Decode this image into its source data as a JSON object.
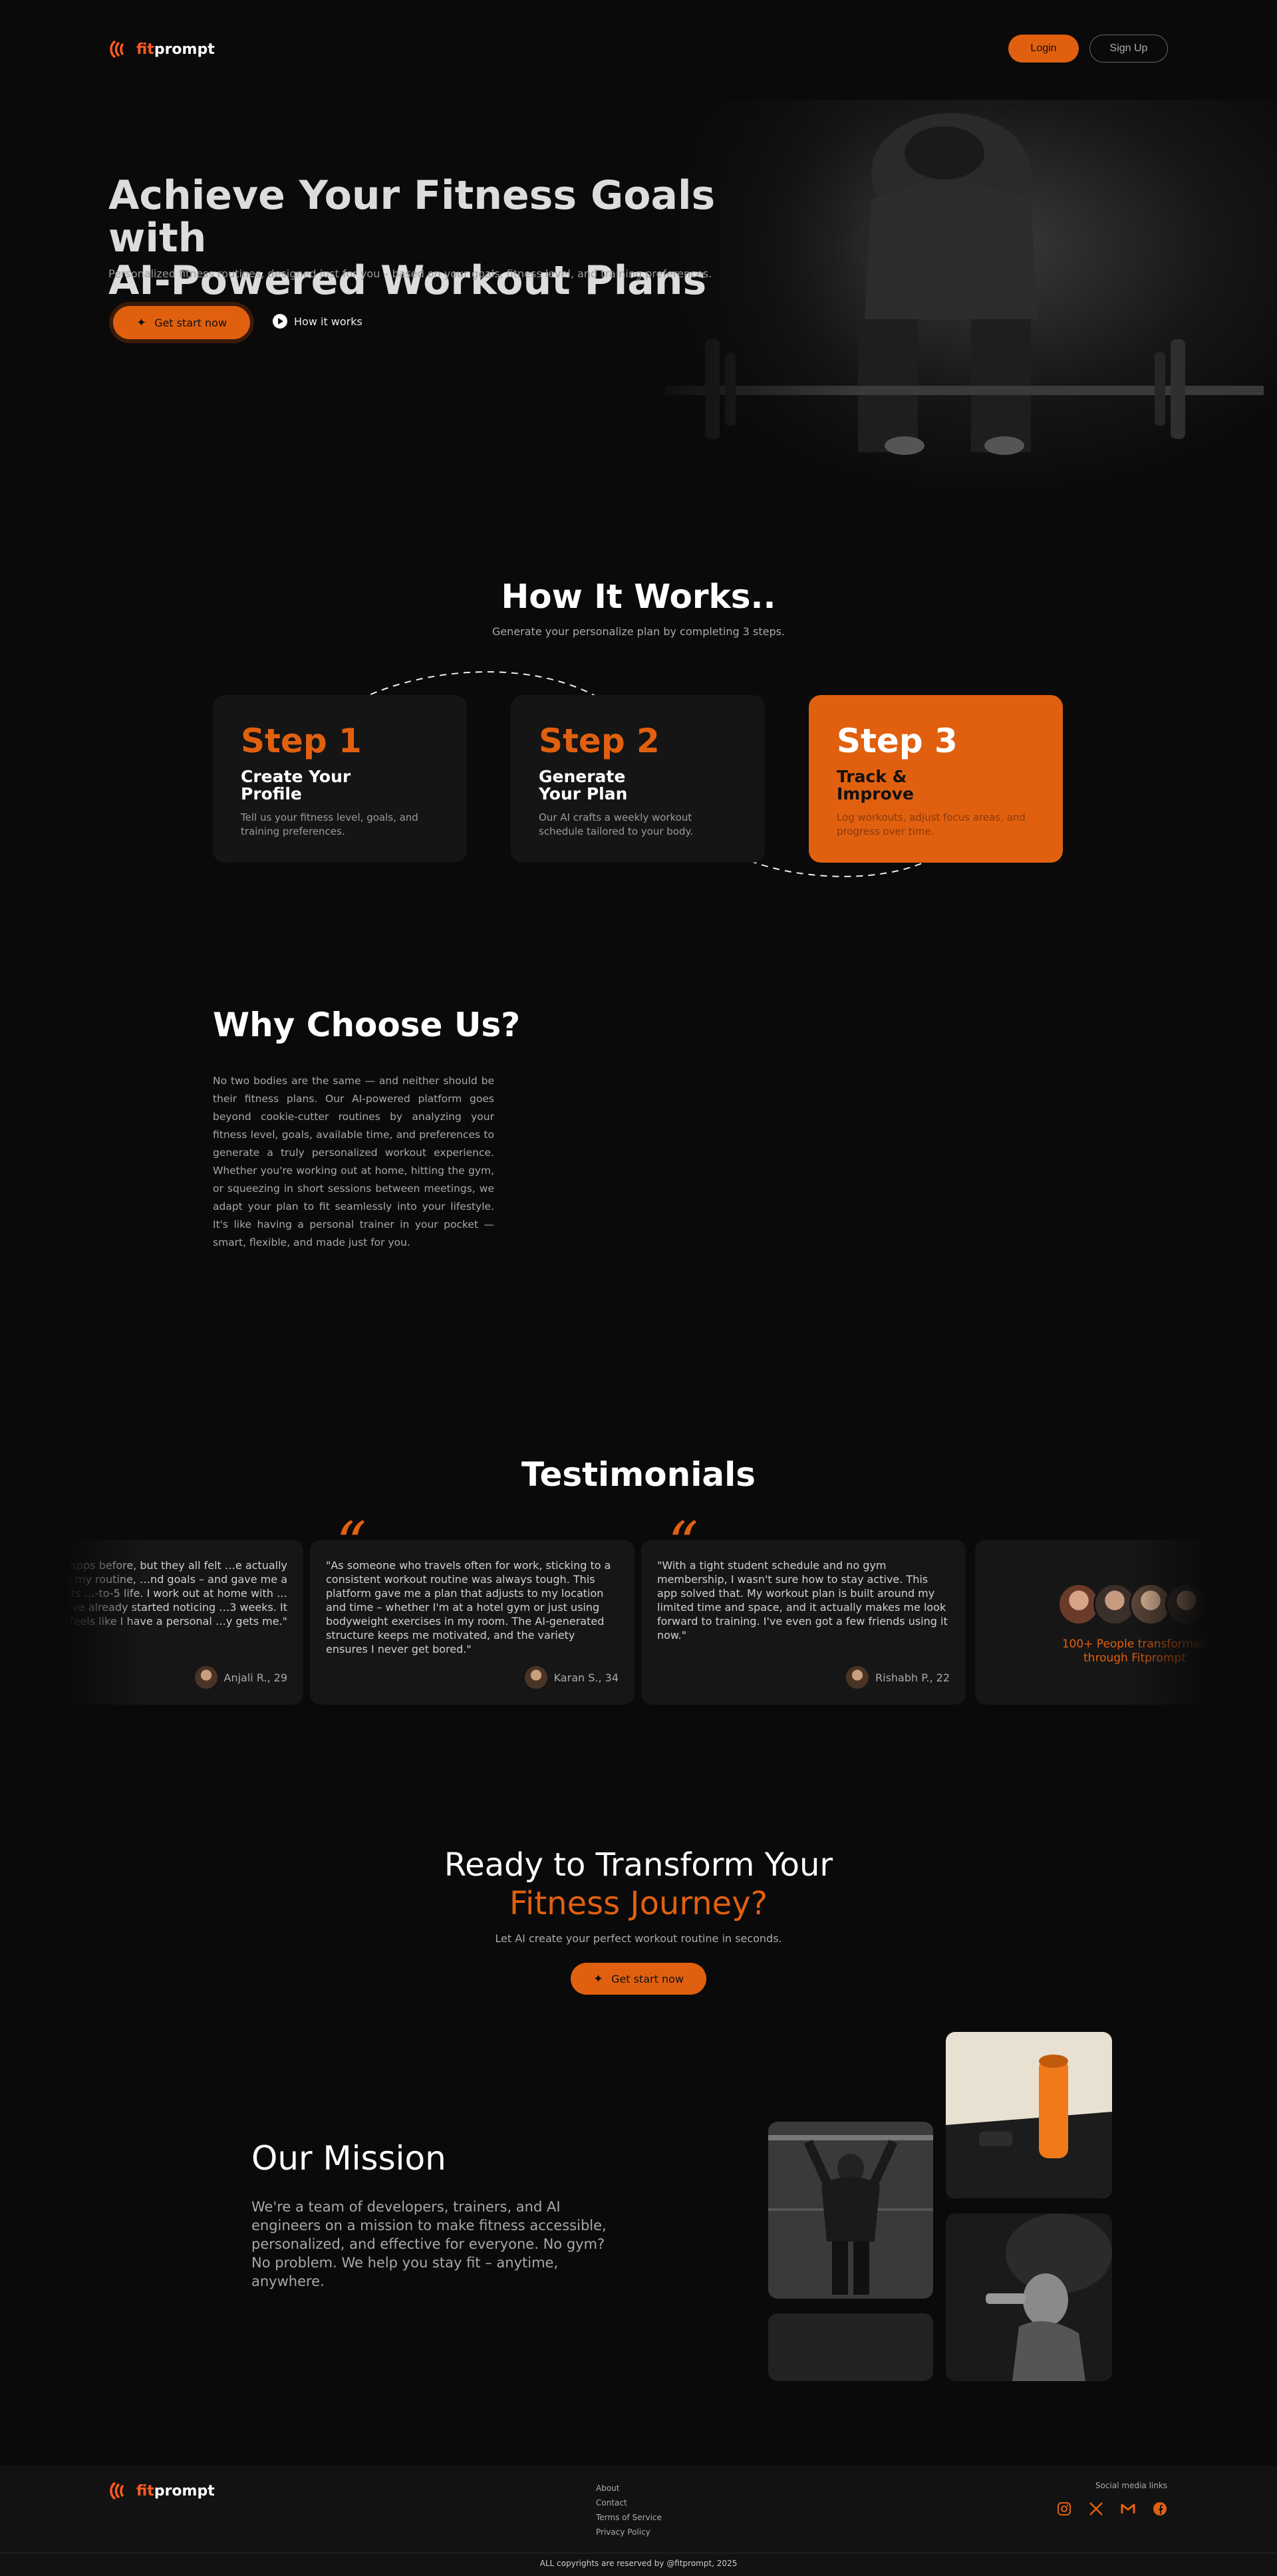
{
  "brand": {
    "prefix": "fit",
    "name": "prompt",
    "accent": "#e1600f"
  },
  "nav": {
    "login": "Login",
    "signup": "Sign Up"
  },
  "hero": {
    "title_line1": "Achieve Your Fitness Goals with",
    "title_line2": "AI-Powered Workout Plans",
    "subtitle": "Personalized fitness routines, designed just for you – based on your goals, fitness level, and training preferences.",
    "cta": "Get start now",
    "how_link": "How it works"
  },
  "how": {
    "title": "How It Works..",
    "subtitle": "Generate your personalize plan by completing 3 steps.",
    "steps": [
      {
        "num": "Step 1",
        "head": "Create Your Profile",
        "desc": "Tell us your fitness level, goals, and training preferences."
      },
      {
        "num": "Step 2",
        "head": "Generate Your Plan",
        "desc": "Our AI crafts a weekly workout schedule tailored to your body."
      },
      {
        "num": "Step 3",
        "head": "Track & Improve",
        "desc": "Log workouts, adjust focus areas, and progress over time."
      }
    ]
  },
  "why": {
    "title": "Why Choose Us?",
    "text": "No two bodies are the same — and neither should be their fitness plans. Our AI-powered platform goes beyond cookie-cutter routines by analyzing your fitness level, goals, available time, and preferences to generate a truly personalized workout experience. Whether you're working out at home, hitting the gym, or squeezing in short sessions between meetings, we adapt your plan to fit seamlessly into your lifestyle. It's like having a personal trainer in your pocket — smart, flexible, and made just for you."
  },
  "testimonials": {
    "title": "Testimonials",
    "items": [
      {
        "text": "…al fitness apps before, but they all felt …e actually asked about my routine, …nd goals – and gave me a plan that fits …-to-5 life. I work out at home with …ment, and I've already started noticing …3 weeks. It feels like I have a personal …y gets me.\"",
        "who": "Anjali R., 29"
      },
      {
        "text": "\"As someone who travels often for work, sticking to a consistent workout routine was always tough. This platform gave me a plan that adjusts to my location and time – whether I'm at a hotel gym or just using bodyweight exercises in my room. The AI-generated structure keeps me motivated, and the variety ensures I never get bored.\"",
        "who": "Karan S., 34"
      },
      {
        "text": "\"With a tight student schedule and no gym membership, I wasn't sure how to stay active. This app solved that. My workout plan is built around my limited time and space, and it actually makes me look forward to training. I've even got a few friends using it now.\"",
        "who": "Rishabh P., 22"
      }
    ],
    "people": "100+ People transformed through Fitprompt"
  },
  "cta": {
    "line1": "Ready to Transform Your",
    "line2": "Fitness Journey?",
    "subtitle": "Let AI create your perfect workout routine in seconds.",
    "button": "Get start now"
  },
  "mission": {
    "title": "Our Mission",
    "text": "We're a team of developers, trainers, and AI engineers on a mission to make fitness accessible, personalized, and effective for everyone. No gym? No problem. We help you stay fit – anytime, anywhere."
  },
  "footer": {
    "links": [
      "About",
      "Contact",
      "Terms of Service",
      "Privacy Policy"
    ],
    "social_label": "Social media links",
    "social_icons": [
      "instagram-icon",
      "x-icon",
      "gmail-icon",
      "facebook-icon"
    ],
    "copyright": "ALL copyrights  are reserved by @fitprompt, 2025"
  }
}
